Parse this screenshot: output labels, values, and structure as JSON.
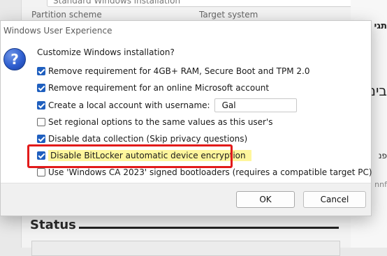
{
  "background": {
    "dropdown_value": "Standard Windows installation",
    "partition_label": "Partition scheme",
    "target_label": "Target system",
    "status_heading": "Status",
    "right_text_1": "תגי",
    "right_text_2": "בים",
    "right_text_3": "פנ",
    "right_text_4": "nnf"
  },
  "dialog": {
    "title": "Windows User Experience",
    "icon": "question-icon",
    "prompt": "Customize Windows installation?",
    "options": [
      {
        "label": "Remove requirement for 4GB+ RAM, Secure Boot and TPM 2.0",
        "checked": true
      },
      {
        "label": "Remove requirement for an online Microsoft account",
        "checked": true
      },
      {
        "label": "Create a local account with username:",
        "checked": true
      },
      {
        "label": "Set regional options to the same values as this user's",
        "checked": false
      },
      {
        "label": "Disable data collection (Skip privacy questions)",
        "checked": true
      },
      {
        "label": "Disable BitLocker automatic device encryption",
        "checked": true
      },
      {
        "label": "Use 'Windows CA 2023' signed bootloaders (requires a compatible target PC)",
        "checked": false
      }
    ],
    "username_value": "Gal",
    "ok_label": "OK",
    "cancel_label": "Cancel"
  },
  "colors": {
    "highlight": "#fff69c",
    "annotation_border": "#e21a1a",
    "checkbox_accent": "#1f5fbf"
  }
}
